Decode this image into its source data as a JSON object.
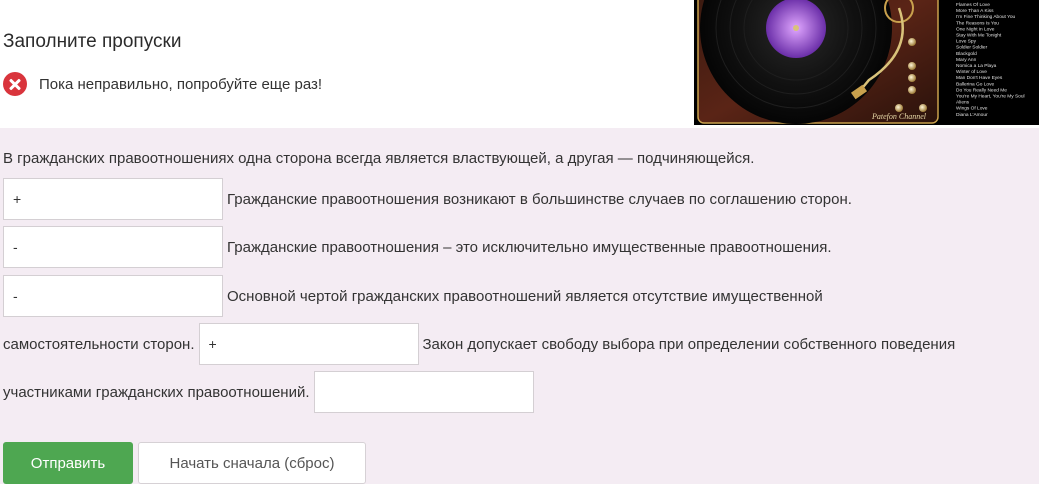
{
  "header": {
    "title": "Заполните пропуски",
    "feedback": "Пока неправильно, попробуйте еще раз!"
  },
  "image": {
    "playlist": [
      "Flames Of Love",
      "More Than A Kiss",
      "I'm Fine Thinking About You",
      "The Reasons Is You",
      "One Night in Love",
      "Stay With Me Tonight",
      "Love Spy",
      "Soldier Soldier",
      "Blackgold",
      "Mary Ann",
      "Nomica a La Playa",
      "Winter of Love",
      "Man Don't Have Eyes",
      "Ballerina Go Love",
      "Do You Really Need Me",
      "You're My Heart, You're My Soul",
      "Aliens",
      "Wings Of Love",
      "Diana L'Amour"
    ],
    "signature": "Patefon Channel"
  },
  "task": {
    "intro": "В гражданских правоотношениях одна сторона всегда является властвующей, а другая — подчиняющейся.",
    "rows": [
      {
        "value": "+",
        "text": "Гражданские правоотношения возникают в большинстве случаев по соглашению сторон."
      },
      {
        "value": "-",
        "text": "Гражданские правоотношения – это исключительно имущественные правоотношения."
      },
      {
        "value": "-",
        "text": "Основной чертой гражданских правоотношений является отсутствие имущественной"
      },
      {
        "before": "самостоятельности сторон.",
        "value": "+",
        "text": "Закон допускает свободу выбора при определении собственного поведения"
      },
      {
        "before": "участниками гражданских правоотношений.",
        "value": ""
      }
    ]
  },
  "buttons": {
    "submit": "Отправить",
    "reset": "Начать сначала (сброс)"
  },
  "colors": {
    "submit_bg": "#4ea751",
    "error_icon": "#d9343c",
    "task_bg": "#f4ecf3"
  }
}
